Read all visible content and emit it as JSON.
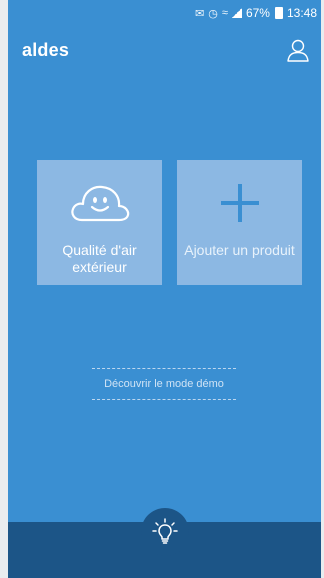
{
  "status_bar": {
    "battery": "67%",
    "time": "13:48",
    "icons": [
      "notification-icon",
      "alarm-icon",
      "wifi-icon",
      "signal-icon",
      "battery-icon"
    ]
  },
  "header": {
    "logo": "aldes",
    "user_icon": "user-icon"
  },
  "tiles": [
    {
      "label": "Qualité d'air extérieur",
      "icon": "smiling-cloud-icon"
    },
    {
      "label": "Ajouter un produit",
      "icon": "plus-icon"
    }
  ],
  "demo": {
    "label": "Découvrir le mode démo"
  },
  "bottom_bar": {
    "icon": "lightbulb-icon"
  },
  "colors": {
    "background": "#3a8fd2",
    "tile": "#8cb8e3",
    "bottom_bar": "#1c5587",
    "text": "#ffffff"
  }
}
